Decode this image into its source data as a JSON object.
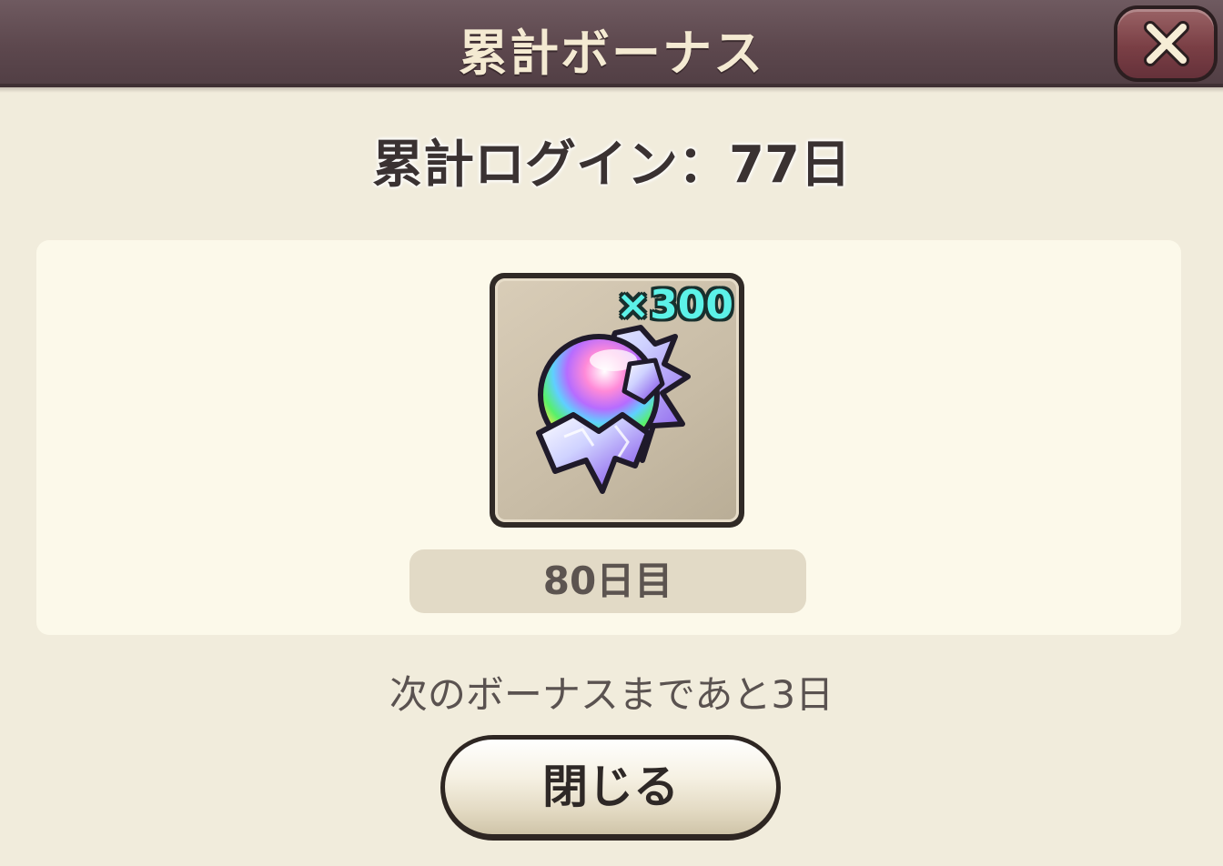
{
  "dialog": {
    "title": "累計ボーナス",
    "close_icon": "close-x-icon",
    "login_count": "累計ログイン：77日",
    "reward": {
      "icon": "rainbow-crystal-orb-icon",
      "quantity": "×300",
      "day_label": "80日目"
    },
    "next_bonus_text": "次のボーナスまであと3日",
    "close_button_label": "閉じる"
  },
  "colors": {
    "titlebar": "#5d484e",
    "title_text": "#f4ead2",
    "close_button": "#7a3f45",
    "background": "#f1ecdc",
    "panel": "#fcf9ea",
    "quantity_text": "#5cf2e8"
  }
}
